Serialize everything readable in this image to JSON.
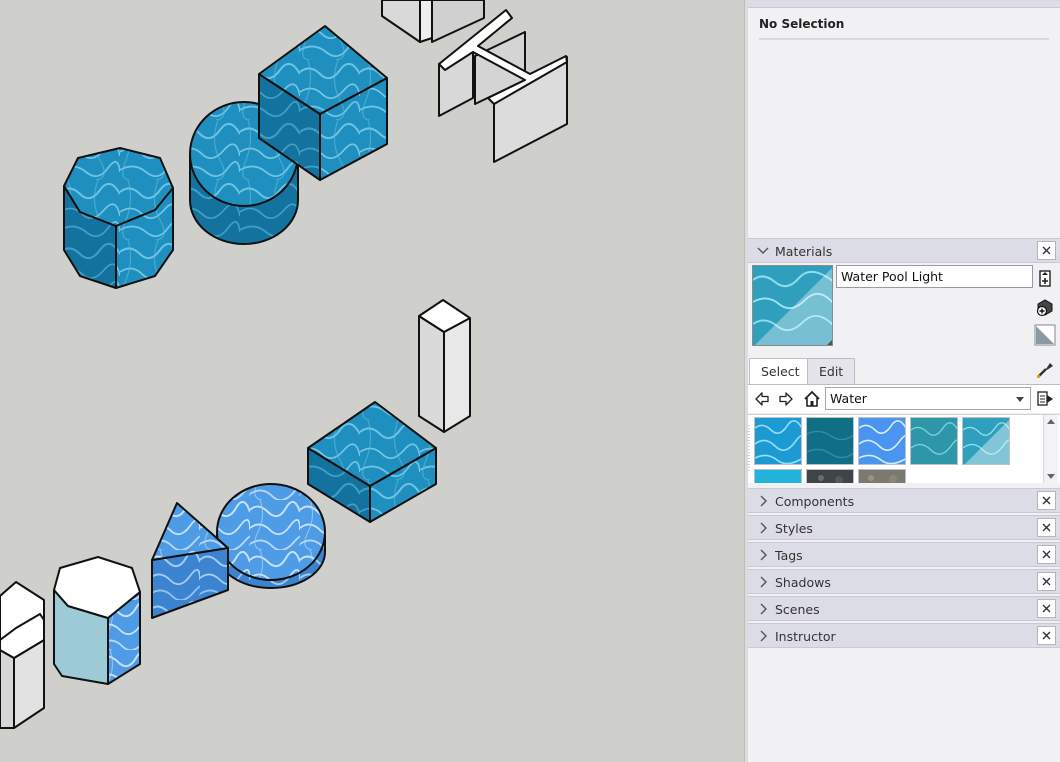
{
  "entity_info": {
    "title": "No Selection"
  },
  "materials": {
    "title": "Materials",
    "material_name": "Water Pool Light",
    "tabs": [
      "Select",
      "Edit"
    ],
    "library": "Water",
    "thumbnails": [
      "water-pool-bright",
      "water-deep-teal",
      "water-pool-blue",
      "water-teal-rippled",
      "water-pool-light",
      "water-turquoise",
      "stone-dark",
      "stone-sand"
    ]
  },
  "panels": [
    "Components",
    "Styles",
    "Tags",
    "Shadows",
    "Scenes",
    "Instructor"
  ],
  "colors": {
    "tray_background": "#f1f1f4",
    "panel_header": "#dcdce6",
    "viewport_background": "#cfcfcb",
    "water_primary": "#1f8fbf",
    "water_light": "#5aa6e6"
  }
}
